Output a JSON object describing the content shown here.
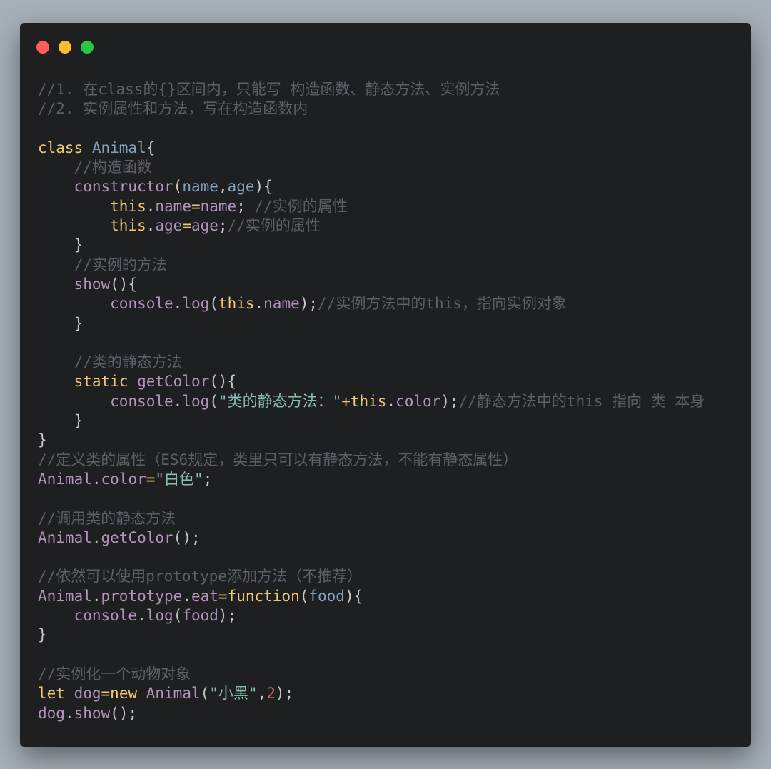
{
  "window": {
    "controls": [
      {
        "name": "close",
        "color": "#ff5f57"
      },
      {
        "name": "minimize",
        "color": "#febc2e"
      },
      {
        "name": "maximize",
        "color": "#28c840"
      }
    ]
  },
  "code": {
    "lines": [
      [
        [
          "comment",
          "//1. 在class的{}区间内，只能写 构造函数、静态方法、实例方法"
        ]
      ],
      [
        [
          "comment",
          "//2. 实例属性和方法，写在构造函数内"
        ]
      ],
      [],
      [
        [
          "keyword",
          "class "
        ],
        [
          "class",
          "Animal"
        ],
        [
          "punct",
          "{"
        ]
      ],
      [
        [
          "plain",
          "    "
        ],
        [
          "comment",
          "//构造函数"
        ]
      ],
      [
        [
          "plain",
          "    "
        ],
        [
          "function",
          "constructor"
        ],
        [
          "punct",
          "("
        ],
        [
          "param",
          "name"
        ],
        [
          "punct",
          ","
        ],
        [
          "param",
          "age"
        ],
        [
          "punct",
          "){"
        ]
      ],
      [
        [
          "plain",
          "        "
        ],
        [
          "this",
          "this"
        ],
        [
          "punct",
          "."
        ],
        [
          "property",
          "name"
        ],
        [
          "op",
          "="
        ],
        [
          "property",
          "name"
        ],
        [
          "punct",
          "; "
        ],
        [
          "comment",
          "//实例的属性"
        ]
      ],
      [
        [
          "plain",
          "        "
        ],
        [
          "this",
          "this"
        ],
        [
          "punct",
          "."
        ],
        [
          "property",
          "age"
        ],
        [
          "op",
          "="
        ],
        [
          "property",
          "age"
        ],
        [
          "punct",
          ";"
        ],
        [
          "comment",
          "//实例的属性"
        ]
      ],
      [
        [
          "plain",
          "    "
        ],
        [
          "punct",
          "}"
        ]
      ],
      [
        [
          "plain",
          "    "
        ],
        [
          "comment",
          "//实例的方法"
        ]
      ],
      [
        [
          "plain",
          "    "
        ],
        [
          "function",
          "show"
        ],
        [
          "punct",
          "(){"
        ]
      ],
      [
        [
          "plain",
          "        "
        ],
        [
          "function",
          "console"
        ],
        [
          "punct",
          "."
        ],
        [
          "function",
          "log"
        ],
        [
          "punct",
          "("
        ],
        [
          "this",
          "this"
        ],
        [
          "punct",
          "."
        ],
        [
          "property",
          "name"
        ],
        [
          "punct",
          ");"
        ],
        [
          "comment",
          "//实例方法中的this，指向实例对象"
        ]
      ],
      [
        [
          "plain",
          "    "
        ],
        [
          "punct",
          "}"
        ]
      ],
      [],
      [
        [
          "plain",
          "    "
        ],
        [
          "comment",
          "//类的静态方法"
        ]
      ],
      [
        [
          "plain",
          "    "
        ],
        [
          "keyword",
          "static "
        ],
        [
          "function",
          "getColor"
        ],
        [
          "punct",
          "(){"
        ]
      ],
      [
        [
          "plain",
          "        "
        ],
        [
          "function",
          "console"
        ],
        [
          "punct",
          "."
        ],
        [
          "function",
          "log"
        ],
        [
          "punct",
          "("
        ],
        [
          "string",
          "\"类的静态方法：\""
        ],
        [
          "op",
          "+"
        ],
        [
          "this",
          "this"
        ],
        [
          "punct",
          "."
        ],
        [
          "property",
          "color"
        ],
        [
          "punct",
          ");"
        ],
        [
          "comment",
          "//静态方法中的this 指向 类 本身"
        ]
      ],
      [
        [
          "plain",
          "    "
        ],
        [
          "punct",
          "}"
        ]
      ],
      [
        [
          "punct",
          "}"
        ]
      ],
      [
        [
          "comment",
          "//定义类的属性（ES6规定，类里只可以有静态方法，不能有静态属性）"
        ]
      ],
      [
        [
          "function",
          "Animal"
        ],
        [
          "punct",
          "."
        ],
        [
          "property",
          "color"
        ],
        [
          "op",
          "="
        ],
        [
          "string",
          "\"白色\""
        ],
        [
          "punct",
          ";"
        ]
      ],
      [],
      [
        [
          "comment",
          "//调用类的静态方法"
        ]
      ],
      [
        [
          "function",
          "Animal"
        ],
        [
          "punct",
          "."
        ],
        [
          "function",
          "getColor"
        ],
        [
          "punct",
          "();"
        ]
      ],
      [],
      [
        [
          "comment",
          "//依然可以使用prototype添加方法（不推荐）"
        ]
      ],
      [
        [
          "function",
          "Animal"
        ],
        [
          "punct",
          "."
        ],
        [
          "property",
          "prototype"
        ],
        [
          "punct",
          "."
        ],
        [
          "property",
          "eat"
        ],
        [
          "op",
          "="
        ],
        [
          "keyword",
          "function"
        ],
        [
          "punct",
          "("
        ],
        [
          "param",
          "food"
        ],
        [
          "punct",
          "){"
        ]
      ],
      [
        [
          "plain",
          "    "
        ],
        [
          "function",
          "console"
        ],
        [
          "punct",
          "."
        ],
        [
          "function",
          "log"
        ],
        [
          "punct",
          "("
        ],
        [
          "property",
          "food"
        ],
        [
          "punct",
          ");"
        ]
      ],
      [
        [
          "punct",
          "}"
        ]
      ],
      [],
      [
        [
          "comment",
          "//实例化一个动物对象"
        ]
      ],
      [
        [
          "keyword",
          "let "
        ],
        [
          "property",
          "dog"
        ],
        [
          "op",
          "="
        ],
        [
          "keyword",
          "new "
        ],
        [
          "function",
          "Animal"
        ],
        [
          "punct",
          "("
        ],
        [
          "string",
          "\"小黑\""
        ],
        [
          "punct",
          ","
        ],
        [
          "number",
          "2"
        ],
        [
          "punct",
          ");"
        ]
      ],
      [
        [
          "property",
          "dog"
        ],
        [
          "punct",
          "."
        ],
        [
          "function",
          "show"
        ],
        [
          "punct",
          "();"
        ]
      ]
    ]
  }
}
